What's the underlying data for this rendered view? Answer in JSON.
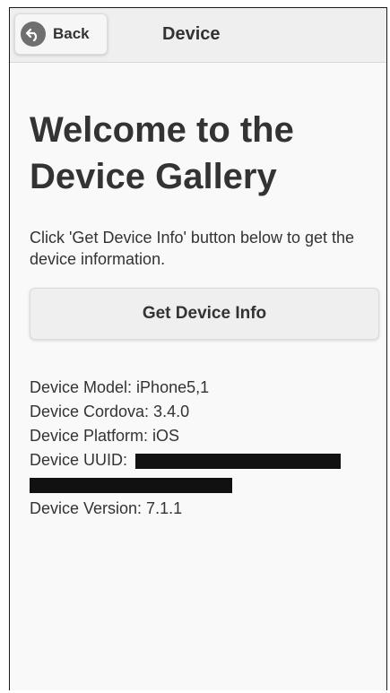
{
  "header": {
    "back_label": "Back",
    "title": "Device",
    "back_icon": "back-arrow-icon"
  },
  "main": {
    "heading_line1": "Welcome to the",
    "heading_line2": "Device Gallery",
    "instructions": "Click 'Get Device Info' button below to get the device information.",
    "button_label": "Get Device Info"
  },
  "device_info": {
    "model": "Device Model: iPhone5,1",
    "cordova": "Device Cordova: 3.4.0",
    "platform": "Device Platform: iOS",
    "uuid_label": "Device UUID:",
    "version": "Device Version: 7.1.1"
  },
  "colors": {
    "page_bg": "#f9f9f9",
    "header_bg": "#efefef",
    "text": "#333333",
    "redaction": "#111111"
  }
}
